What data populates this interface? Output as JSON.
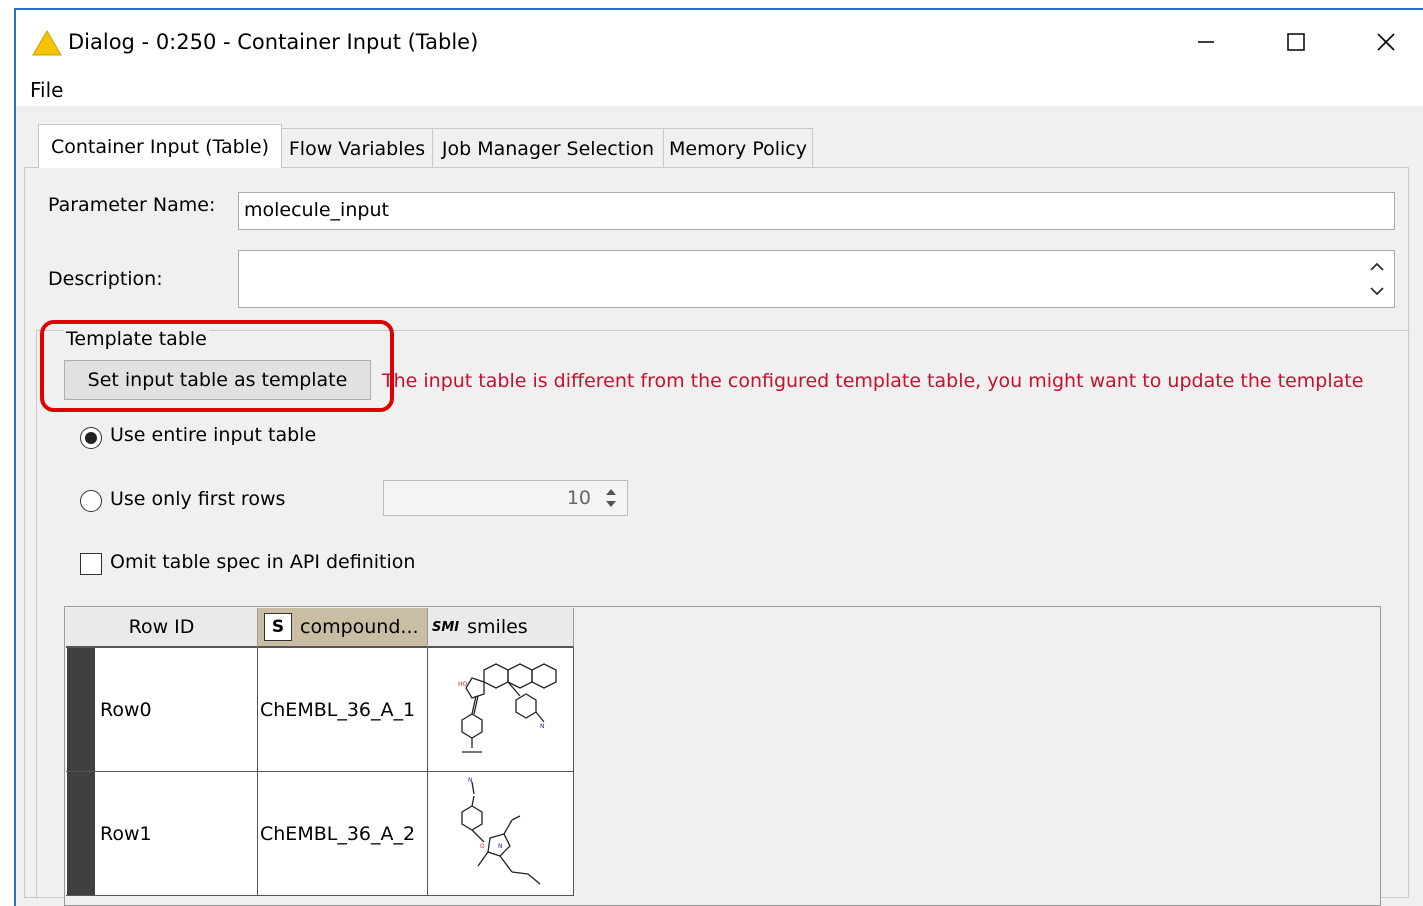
{
  "window": {
    "title": "Dialog - 0:250 - Container Input (Table)",
    "minimize_glyph": "—",
    "maximize_glyph": "☐",
    "close_glyph": "✕",
    "accent_color": "#2b6fc9"
  },
  "menu": {
    "file": "File"
  },
  "tabs": [
    {
      "label": "Container Input (Table)",
      "active": true
    },
    {
      "label": "Flow Variables",
      "active": false
    },
    {
      "label": "Job Manager Selection",
      "active": false
    },
    {
      "label": "Memory Policy",
      "active": false
    }
  ],
  "form": {
    "parameter_name_label": "Parameter Name:",
    "parameter_name_value": "molecule_input",
    "description_label": "Description:",
    "description_value": ""
  },
  "template": {
    "legend": "Template table",
    "set_button": "Set input table as template",
    "warning": "The input table is different from the configured template table, you might want to update the template",
    "warning_color": "#c8102e",
    "use_entire_label": "Use entire input table",
    "use_entire_selected": true,
    "use_first_rows_label": "Use only first rows",
    "first_rows_value": "10",
    "omit_spec_label": "Omit table spec in API definition",
    "omit_spec_checked": false
  },
  "table": {
    "columns": [
      {
        "label": "Row ID",
        "type_badge": ""
      },
      {
        "label": "compound...",
        "type_badge": "S"
      },
      {
        "label": "smiles",
        "type_badge": "SMI"
      }
    ],
    "rows": [
      {
        "row_id": "Row0",
        "compound": "ChEMBL_36_A_1",
        "smiles_icon": "molecule-structure-image"
      },
      {
        "row_id": "Row1",
        "compound": "ChEMBL_36_A_2",
        "smiles_icon": "molecule-structure-image"
      }
    ]
  }
}
